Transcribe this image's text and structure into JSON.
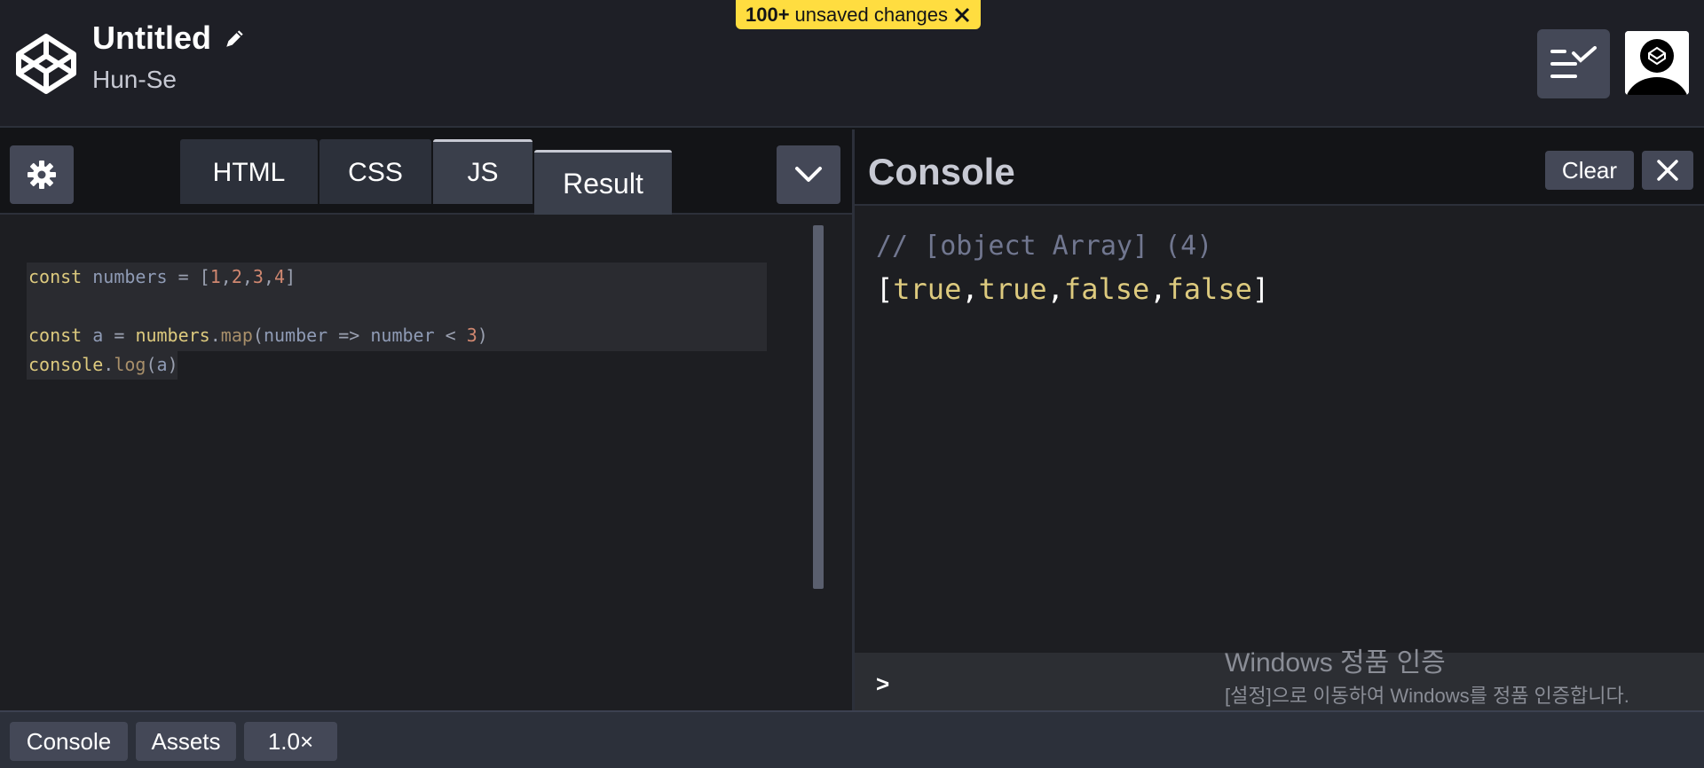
{
  "header": {
    "title": "Untitled",
    "author": "Hun-Se",
    "unsaved_count": "100+",
    "unsaved_text": "unsaved changes"
  },
  "editor": {
    "tabs": [
      {
        "label": "HTML"
      },
      {
        "label": "CSS"
      },
      {
        "label": "JS"
      },
      {
        "label": "Result"
      }
    ],
    "code": {
      "line1": {
        "kw": "const",
        "name": "numbers",
        "eq": " = [",
        "n1": "1",
        "n2": "2",
        "n3": "3",
        "n4": "4",
        "close": "]"
      },
      "line3": {
        "kw": "const",
        "name": "a",
        "eq": " = ",
        "obj": "numbers",
        "dot": ".",
        "fn": "map",
        "open": "(",
        "arg": "number",
        "arrow": " => ",
        "arg2": "number",
        "lt": " < ",
        "num": "3",
        "close": ")"
      },
      "line4": {
        "obj": "console",
        "dot": ".",
        "fn": "log",
        "open": "(",
        "arg": "a",
        "close": ")"
      }
    }
  },
  "console": {
    "title": "Console",
    "clear_label": "Clear",
    "comment": "// [object Array] (4)",
    "result": {
      "open": "[",
      "v1": "true",
      "v2": "true",
      "v3": "false",
      "v4": "false",
      "sep": ",",
      "close": "]"
    },
    "prompt": ">"
  },
  "watermark": {
    "title": "Windows 정품 인증",
    "subtitle": "[설정]으로 이동하여 Windows를 정품 인증합니다."
  },
  "footer": {
    "console_label": "Console",
    "assets_label": "Assets",
    "zoom_label": "1.0×"
  },
  "colors": {
    "unsaved_badge": "#ffdd40",
    "keyword": "#ddca7e",
    "number": "#d08770",
    "background": "#131417"
  }
}
